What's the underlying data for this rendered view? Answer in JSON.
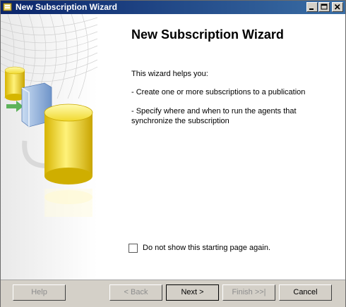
{
  "window": {
    "title": "New Subscription Wizard",
    "icons": {
      "app": "wizard-app-icon",
      "minimize": "minimize-icon",
      "maximize": "maximize-icon",
      "close": "close-icon"
    }
  },
  "main": {
    "heading": "New Subscription Wizard",
    "intro": "This wizard helps you:",
    "bullets": [
      "- Create one or more subscriptions to a publication",
      "- Specify where and when to run the agents that synchronize the subscription"
    ],
    "checkbox": {
      "label": "Do not show this starting page again.",
      "checked": false
    }
  },
  "buttons": {
    "help": "Help",
    "back": "< Back",
    "next": "Next >",
    "finish": "Finish >>|",
    "cancel": "Cancel"
  },
  "colors": {
    "titlebar_start": "#0a246a",
    "titlebar_end": "#3a6ea5",
    "dialog_face": "#d4d0c8",
    "accent_yellow": "#f2d600"
  },
  "side_graphic": {
    "icon": "database-replication-graphic"
  }
}
